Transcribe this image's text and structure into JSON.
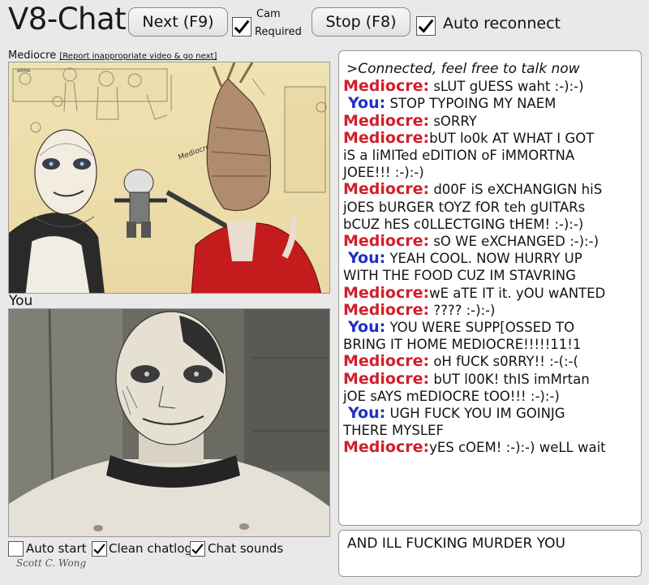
{
  "header": {
    "app_title": "V8-Chat",
    "next_button": "Next (F9)",
    "cam_label_line1": "Cam",
    "cam_label_line2": "Required",
    "stop_button": "Stop (F8)",
    "auto_reconnect_label": "Auto reconnect",
    "cam_required_checked": true,
    "auto_reconnect_checked": true
  },
  "stranger": {
    "name": "Mediocre",
    "report_link": "[Report inappropriate video & go next]"
  },
  "self": {
    "label": "You"
  },
  "chat": {
    "system_message": ">Connected, feel free to talk now",
    "messages": [
      {
        "sender": "Mediocre:",
        "who": "stranger",
        "lines": [
          " sLUT gUESS waht :-):-)"
        ]
      },
      {
        "sender": "You:",
        "who": "you",
        "lines": [
          " STOP TYPOING MY NAEM"
        ]
      },
      {
        "sender": "Mediocre:",
        "who": "stranger",
        "lines": [
          " sORRY"
        ]
      },
      {
        "sender": "Mediocre:",
        "who": "stranger",
        "lines": [
          "bUT lo0k AT WHAT I GOT",
          "iS a liMITed eDITION oF iMMORTNA",
          "JOEE!!! :-):-)"
        ]
      },
      {
        "sender": "Mediocre:",
        "who": "stranger",
        "lines": [
          " d00F iS eXCHANGIGN hiS",
          "jOES bURGER tOYZ fOR teh gUITARs",
          "bCUZ hES c0LLECTGING tHEM! :-):-)"
        ]
      },
      {
        "sender": "Mediocre:",
        "who": "stranger",
        "lines": [
          " sO WE eXCHANGED :-):-)"
        ]
      },
      {
        "sender": "You:",
        "who": "you",
        "lines": [
          " YEAH COOL. NOW HURRY UP",
          "WITH THE FOOD CUZ IM STAVRING"
        ]
      },
      {
        "sender": "Mediocre:",
        "who": "stranger",
        "lines": [
          "wE aTE IT it. yOU wANTED"
        ]
      },
      {
        "sender": "Mediocre:",
        "who": "stranger",
        "lines": [
          " ???? :-):-)"
        ]
      },
      {
        "sender": "You:",
        "who": "you",
        "lines": [
          "  YOU WERE SUPP[OSSED TO",
          "BRING IT HOME MEDIOCRE!!!!!11!1"
        ]
      },
      {
        "sender": "Mediocre:",
        "who": "stranger",
        "lines": [
          " oH fUCK s0RRY!! :-(:-("
        ]
      },
      {
        "sender": "Mediocre:",
        "who": "stranger",
        "lines": [
          " bUT l00K! thIS imMrtan",
          "jOE sAYS mEDIOCRE tOO!!! :-):-)"
        ]
      },
      {
        "sender": "You:",
        "who": "you",
        "lines": [
          " UGH FUCK YOU IM GOINJG",
          "THERE MYSLEF"
        ]
      },
      {
        "sender": "Mediocre:",
        "who": "stranger",
        "lines": [
          "yES cOEM! :-):-) weLL wait"
        ]
      }
    ]
  },
  "input": {
    "value": "AND ILL FUCKING MURDER YOU"
  },
  "options": {
    "auto_start": "Auto start",
    "clean_chatlog": "Clean chatlog",
    "chat_sounds": "Chat sounds",
    "auto_start_checked": false,
    "clean_chatlog_checked": true,
    "chat_sounds_checked": true
  },
  "artist_signature": "Scott C. Wong",
  "video_art_text": {
    "speech": "Mediocre!",
    "corner": "ARRA"
  }
}
